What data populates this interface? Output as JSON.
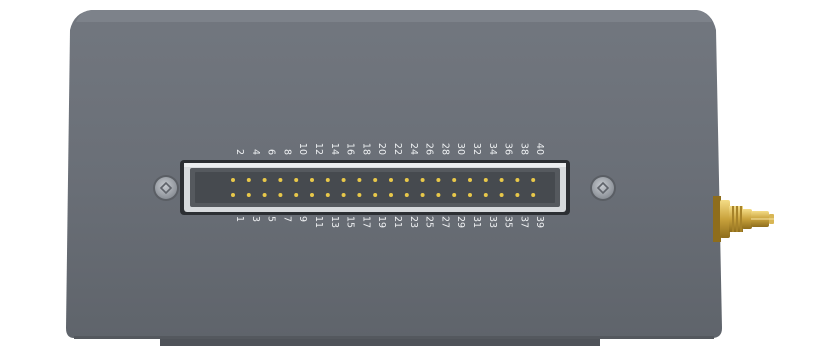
{
  "device": {
    "body_color": "#6b7078",
    "body_shadow": "#575b62",
    "port_frame_color": "#2d3034",
    "port_inner_color": "#4e5257",
    "pin_color": "#e8c84a",
    "connector_color": "#c9a440",
    "label_color": "#eef0f2"
  },
  "header": {
    "pin_count": 40,
    "top_row_labels": [
      "2",
      "4",
      "6",
      "8",
      "10",
      "12",
      "14",
      "16",
      "18",
      "20",
      "22",
      "24",
      "26",
      "28",
      "30",
      "32",
      "34",
      "36",
      "38",
      "40"
    ],
    "bottom_row_labels": [
      "1",
      "3",
      "5",
      "7",
      "9",
      "11",
      "13",
      "15",
      "17",
      "19",
      "21",
      "23",
      "25",
      "27",
      "29",
      "31",
      "33",
      "35",
      "37",
      "39"
    ]
  },
  "parts": {
    "left_screw_icon": "screw-icon",
    "right_screw_icon": "screw-icon",
    "antenna_connector_icon": "sma-connector-icon"
  }
}
